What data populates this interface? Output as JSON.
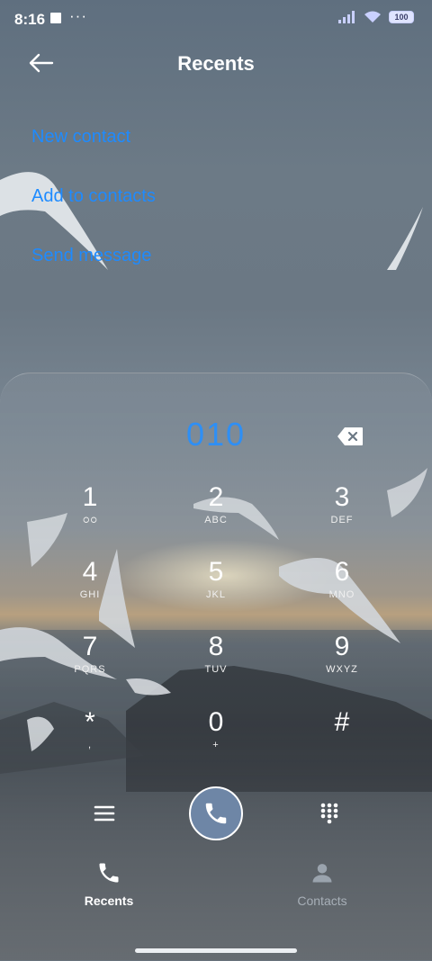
{
  "status_bar": {
    "time": "8:16",
    "dots": "···",
    "battery": "100"
  },
  "header": {
    "title": "Recents"
  },
  "actions": {
    "new_contact": "New contact",
    "add_to_contacts": "Add to contacts",
    "send_message": "Send message"
  },
  "dialer": {
    "number": "010",
    "accent_color": "#2e8ff5",
    "keys": [
      {
        "digit": "1",
        "letters": "ഠഠ"
      },
      {
        "digit": "2",
        "letters": "ABC"
      },
      {
        "digit": "3",
        "letters": "DEF"
      },
      {
        "digit": "4",
        "letters": "GHI"
      },
      {
        "digit": "5",
        "letters": "JKL"
      },
      {
        "digit": "6",
        "letters": "MNO"
      },
      {
        "digit": "7",
        "letters": "PQRS"
      },
      {
        "digit": "8",
        "letters": "TUV"
      },
      {
        "digit": "9",
        "letters": "WXYZ"
      },
      {
        "digit": "*",
        "letters": ","
      },
      {
        "digit": "0",
        "letters": "+"
      },
      {
        "digit": "#",
        "letters": ""
      }
    ]
  },
  "bottom_nav": {
    "recents_label": "Recents",
    "contacts_label": "Contacts"
  }
}
